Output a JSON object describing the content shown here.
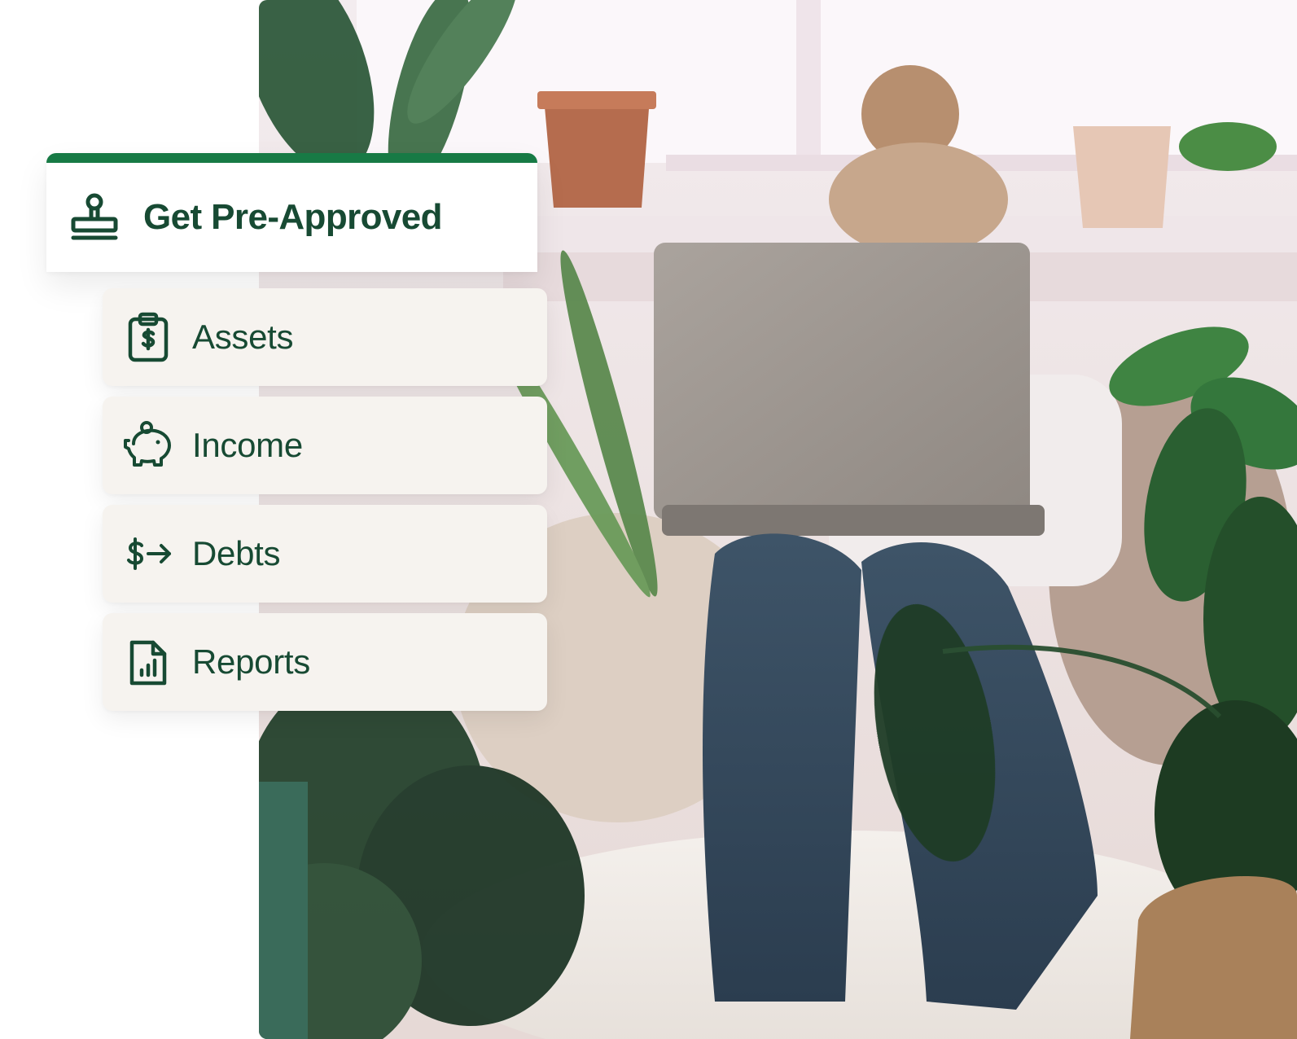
{
  "preapproval": {
    "title": "Get Pre-Approved",
    "icon": "stamp-icon"
  },
  "menu": {
    "items": [
      {
        "label": "Assets",
        "icon": "clipboard-dollar-icon"
      },
      {
        "label": "Income",
        "icon": "piggy-bank-icon"
      },
      {
        "label": "Debts",
        "icon": "dollar-arrow-icon"
      },
      {
        "label": "Reports",
        "icon": "document-chart-icon"
      }
    ]
  },
  "colors": {
    "accent_green": "#177a45",
    "text_dark_green": "#174a33",
    "menu_item_bg": "#f6f3ef"
  }
}
